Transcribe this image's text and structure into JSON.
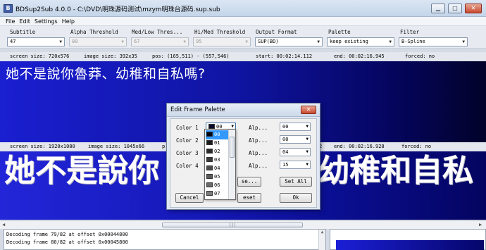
{
  "window": {
    "title": "BDSup2Sub 4.0.0 - C:\\DVD\\明珠源码测试\\mzym明珠台源码.sup.sub",
    "icon_text": "B",
    "min_glyph": "▁",
    "max_glyph": "□",
    "close_glyph": "✕"
  },
  "menu": [
    "File",
    "Edit",
    "Settings",
    "Help"
  ],
  "toolbar": {
    "subtitle": {
      "label": "Subtitle",
      "value": "47"
    },
    "alpha_threshold": {
      "label": "Alpha Threshold",
      "value": "80"
    },
    "med_low_threshold": {
      "label": "Med/Low Thres...",
      "value": "67"
    },
    "hi_med_threshold": {
      "label": "Hi/Med Threshold",
      "value": "95"
    },
    "output_format": {
      "label": "Output Format",
      "value": "SUP(BD)"
    },
    "palette": {
      "label": "Palette",
      "value": "keep existing"
    },
    "filter": {
      "label": "Filter",
      "value": "B-Spline"
    }
  },
  "source_info": {
    "screen_size": "screen size: 720x576",
    "image_size": "image size: 392x35",
    "pos": "pos: (165,511) - (557,546)",
    "start": "start: 00:02:14.112",
    "end": "end: 00:02:16.945",
    "forced": "forced: no"
  },
  "target_info": {
    "screen_size": "screen size: 1920x1080",
    "image_size": "image size: 1045x66",
    "pos": "p",
    "end_prefix": "2",
    "end": "end: 00:02:16.928",
    "forced": "forced: no"
  },
  "subtitle_source": "她不是說你魯莽、幼稚和自私嗎?",
  "subtitle_target_left": "她不是說你",
  "subtitle_target_right": "幼稚和自私",
  "scrollbar_grip": "|||",
  "log_lines": [
    "Decoding frame 79/82 at offset 0x00044800",
    "Decoding frame 80/82 at offset 0x00045800"
  ],
  "dialog": {
    "title": "Edit Frame Palette",
    "close_glyph": "✕",
    "colors": [
      {
        "label": "Color 1",
        "value": "00",
        "swatch": "#0a0a2a",
        "alpha_label": "Alp...",
        "alpha": "00"
      },
      {
        "label": "Color 2",
        "alpha_label": "Alp...",
        "alpha": "00"
      },
      {
        "label": "Color 3",
        "alpha_label": "Alp...",
        "alpha": "04"
      },
      {
        "label": "Color 4",
        "alpha_label": "Alp...",
        "alpha": "15"
      }
    ],
    "buttons": {
      "cancel": "Cancel",
      "default_partial": "se...",
      "reset_partial": "eset",
      "set_all": "Set All",
      "ok": "Ok"
    },
    "dropdown_items": [
      {
        "value": "00",
        "swatch": "#050510"
      },
      {
        "value": "01",
        "swatch": "#1a1a1a"
      },
      {
        "value": "02",
        "swatch": "#2a2a2a"
      },
      {
        "value": "03",
        "swatch": "#3a3a3a"
      },
      {
        "value": "04",
        "swatch": "#4a4a4a"
      },
      {
        "value": "05",
        "swatch": "#5b5b5b"
      },
      {
        "value": "06",
        "swatch": "#6a6a6a"
      },
      {
        "value": "07",
        "swatch": "#7a7a7a"
      }
    ]
  }
}
